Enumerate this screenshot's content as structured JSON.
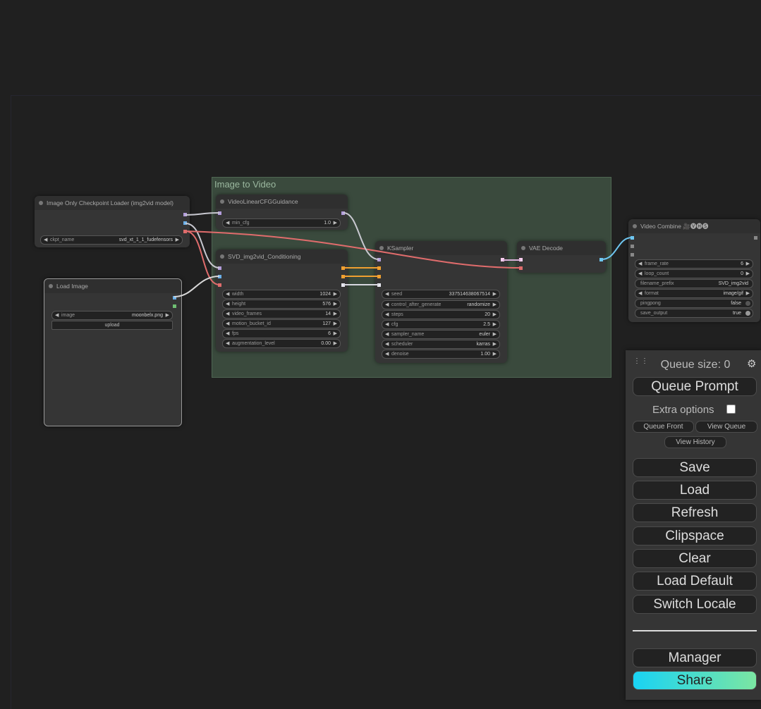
{
  "group": {
    "title": "Image to Video"
  },
  "nodes": {
    "checkpoint": {
      "title": "Image Only Checkpoint Loader (img2vid model)",
      "widgets": [
        {
          "label": "ckpt_name",
          "value": "svd_xt_1_1_fudefensors"
        }
      ]
    },
    "load_image": {
      "title": "Load Image",
      "widgets": [
        {
          "label": "image",
          "value": "moonbelx.png"
        }
      ],
      "upload_label": "upload"
    },
    "cfg_guidance": {
      "title": "VideoLinearCFGGuidance",
      "widgets": [
        {
          "label": "min_cfg",
          "value": "1.0"
        }
      ]
    },
    "conditioning": {
      "title": "SVD_img2vid_Conditioning",
      "widgets": [
        {
          "label": "width",
          "value": "1024"
        },
        {
          "label": "height",
          "value": "576"
        },
        {
          "label": "video_frames",
          "value": "14"
        },
        {
          "label": "motion_bucket_id",
          "value": "127"
        },
        {
          "label": "fps",
          "value": "6"
        },
        {
          "label": "augmentation_level",
          "value": "0.00"
        }
      ]
    },
    "ksampler": {
      "title": "KSampler",
      "widgets": [
        {
          "label": "seed",
          "value": "337514638067514"
        },
        {
          "label": "control_after_generate",
          "value": "randomize"
        },
        {
          "label": "steps",
          "value": "20"
        },
        {
          "label": "cfg",
          "value": "2.5"
        },
        {
          "label": "sampler_name",
          "value": "euler"
        },
        {
          "label": "scheduler",
          "value": "karras"
        },
        {
          "label": "denoise",
          "value": "1.00"
        }
      ]
    },
    "vae_decode": {
      "title": "VAE Decode"
    },
    "video_combine": {
      "title": "Video Combine 🎥🅥🅗🅢",
      "widgets": [
        {
          "label": "frame_rate",
          "value": "6"
        },
        {
          "label": "loop_count",
          "value": "0"
        },
        {
          "label": "filename_prefix",
          "value": "SVD_img2vid"
        },
        {
          "label": "format",
          "value": "image/gif"
        },
        {
          "label": "pingpong",
          "value": "false"
        },
        {
          "label": "save_output",
          "value": "true"
        }
      ]
    }
  },
  "panel": {
    "queue_size": "Queue size: 0",
    "queue_prompt": "Queue Prompt",
    "extra_options": "Extra options",
    "queue_front": "Queue Front",
    "view_queue": "View Queue",
    "view_history": "View History",
    "buttons": [
      "Save",
      "Load",
      "Refresh",
      "Clipspace",
      "Clear",
      "Load Default",
      "Switch Locale"
    ],
    "manager": "Manager",
    "share": "Share"
  },
  "colors": {
    "model_link": "#b39ddb",
    "clip_vision_link": "#ffd500",
    "vae_link": "#ff6e6e",
    "image_link": "#64b5f6",
    "conditioning_link": "#ffa931",
    "latent_link": "#ff9cf9",
    "share_gradient": [
      "#19d3f4",
      "#7be6a2"
    ]
  }
}
